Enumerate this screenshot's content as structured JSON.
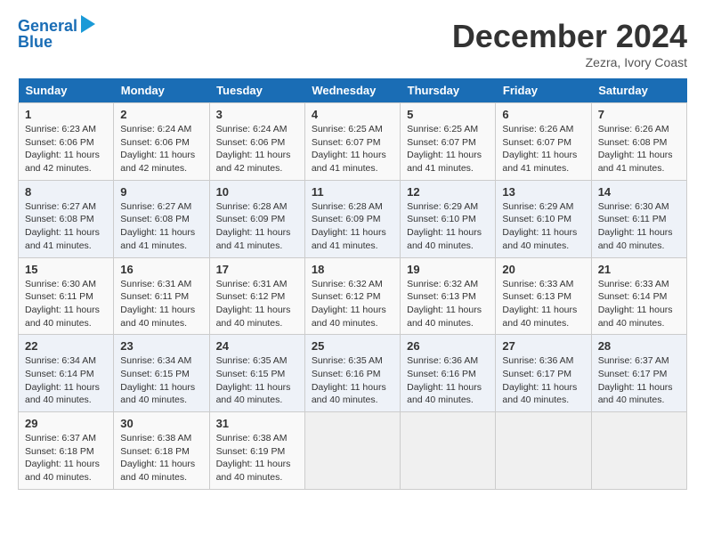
{
  "header": {
    "logo_line1": "General",
    "logo_line2": "Blue",
    "month_year": "December 2024",
    "location": "Zezra, Ivory Coast"
  },
  "weekdays": [
    "Sunday",
    "Monday",
    "Tuesday",
    "Wednesday",
    "Thursday",
    "Friday",
    "Saturday"
  ],
  "weeks": [
    [
      {
        "day": "1",
        "sunrise": "6:23 AM",
        "sunset": "6:06 PM",
        "daylight": "11 hours and 42 minutes."
      },
      {
        "day": "2",
        "sunrise": "6:24 AM",
        "sunset": "6:06 PM",
        "daylight": "11 hours and 42 minutes."
      },
      {
        "day": "3",
        "sunrise": "6:24 AM",
        "sunset": "6:06 PM",
        "daylight": "11 hours and 42 minutes."
      },
      {
        "day": "4",
        "sunrise": "6:25 AM",
        "sunset": "6:07 PM",
        "daylight": "11 hours and 41 minutes."
      },
      {
        "day": "5",
        "sunrise": "6:25 AM",
        "sunset": "6:07 PM",
        "daylight": "11 hours and 41 minutes."
      },
      {
        "day": "6",
        "sunrise": "6:26 AM",
        "sunset": "6:07 PM",
        "daylight": "11 hours and 41 minutes."
      },
      {
        "day": "7",
        "sunrise": "6:26 AM",
        "sunset": "6:08 PM",
        "daylight": "11 hours and 41 minutes."
      }
    ],
    [
      {
        "day": "8",
        "sunrise": "6:27 AM",
        "sunset": "6:08 PM",
        "daylight": "11 hours and 41 minutes."
      },
      {
        "day": "9",
        "sunrise": "6:27 AM",
        "sunset": "6:08 PM",
        "daylight": "11 hours and 41 minutes."
      },
      {
        "day": "10",
        "sunrise": "6:28 AM",
        "sunset": "6:09 PM",
        "daylight": "11 hours and 41 minutes."
      },
      {
        "day": "11",
        "sunrise": "6:28 AM",
        "sunset": "6:09 PM",
        "daylight": "11 hours and 41 minutes."
      },
      {
        "day": "12",
        "sunrise": "6:29 AM",
        "sunset": "6:10 PM",
        "daylight": "11 hours and 40 minutes."
      },
      {
        "day": "13",
        "sunrise": "6:29 AM",
        "sunset": "6:10 PM",
        "daylight": "11 hours and 40 minutes."
      },
      {
        "day": "14",
        "sunrise": "6:30 AM",
        "sunset": "6:11 PM",
        "daylight": "11 hours and 40 minutes."
      }
    ],
    [
      {
        "day": "15",
        "sunrise": "6:30 AM",
        "sunset": "6:11 PM",
        "daylight": "11 hours and 40 minutes."
      },
      {
        "day": "16",
        "sunrise": "6:31 AM",
        "sunset": "6:11 PM",
        "daylight": "11 hours and 40 minutes."
      },
      {
        "day": "17",
        "sunrise": "6:31 AM",
        "sunset": "6:12 PM",
        "daylight": "11 hours and 40 minutes."
      },
      {
        "day": "18",
        "sunrise": "6:32 AM",
        "sunset": "6:12 PM",
        "daylight": "11 hours and 40 minutes."
      },
      {
        "day": "19",
        "sunrise": "6:32 AM",
        "sunset": "6:13 PM",
        "daylight": "11 hours and 40 minutes."
      },
      {
        "day": "20",
        "sunrise": "6:33 AM",
        "sunset": "6:13 PM",
        "daylight": "11 hours and 40 minutes."
      },
      {
        "day": "21",
        "sunrise": "6:33 AM",
        "sunset": "6:14 PM",
        "daylight": "11 hours and 40 minutes."
      }
    ],
    [
      {
        "day": "22",
        "sunrise": "6:34 AM",
        "sunset": "6:14 PM",
        "daylight": "11 hours and 40 minutes."
      },
      {
        "day": "23",
        "sunrise": "6:34 AM",
        "sunset": "6:15 PM",
        "daylight": "11 hours and 40 minutes."
      },
      {
        "day": "24",
        "sunrise": "6:35 AM",
        "sunset": "6:15 PM",
        "daylight": "11 hours and 40 minutes."
      },
      {
        "day": "25",
        "sunrise": "6:35 AM",
        "sunset": "6:16 PM",
        "daylight": "11 hours and 40 minutes."
      },
      {
        "day": "26",
        "sunrise": "6:36 AM",
        "sunset": "6:16 PM",
        "daylight": "11 hours and 40 minutes."
      },
      {
        "day": "27",
        "sunrise": "6:36 AM",
        "sunset": "6:17 PM",
        "daylight": "11 hours and 40 minutes."
      },
      {
        "day": "28",
        "sunrise": "6:37 AM",
        "sunset": "6:17 PM",
        "daylight": "11 hours and 40 minutes."
      }
    ],
    [
      {
        "day": "29",
        "sunrise": "6:37 AM",
        "sunset": "6:18 PM",
        "daylight": "11 hours and 40 minutes."
      },
      {
        "day": "30",
        "sunrise": "6:38 AM",
        "sunset": "6:18 PM",
        "daylight": "11 hours and 40 minutes."
      },
      {
        "day": "31",
        "sunrise": "6:38 AM",
        "sunset": "6:19 PM",
        "daylight": "11 hours and 40 minutes."
      },
      null,
      null,
      null,
      null
    ]
  ]
}
